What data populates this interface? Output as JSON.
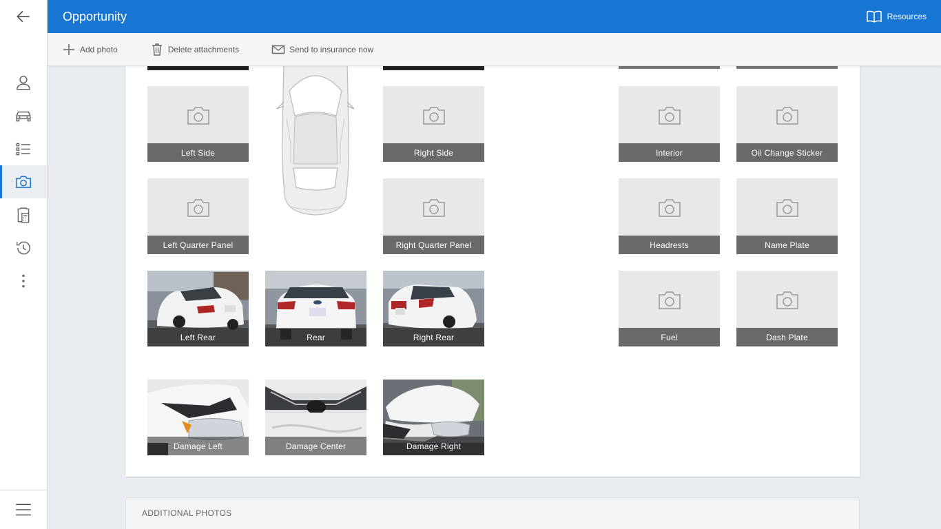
{
  "header": {
    "title": "Opportunity",
    "resources_label": "Resources"
  },
  "toolbar": {
    "add_photo": "Add photo",
    "delete_attachments": "Delete attachments",
    "send_insurance": "Send to insurance now"
  },
  "nav": {
    "items": [
      "back-arrow-icon",
      "user-icon",
      "car-icon",
      "checklist-icon",
      "camera-icon",
      "clipboard-calculator-icon",
      "history-icon",
      "more-vertical-icon"
    ],
    "active": "camera-icon",
    "bottom": "menu-icon"
  },
  "photos": {
    "left_side": "Left Side",
    "right_side": "Right Side",
    "left_quarter_panel": "Left Quarter Panel",
    "right_quarter_panel": "Right Quarter Panel",
    "left_rear": "Left Rear",
    "rear": "Rear",
    "right_rear": "Right Rear",
    "damage_left": "Damage Left",
    "damage_center": "Damage Center",
    "damage_right": "Damage Right",
    "interior": "Interior",
    "oil_change_sticker": "Oil Change Sticker",
    "headrests": "Headrests",
    "name_plate": "Name Plate",
    "fuel": "Fuel",
    "dash_plate": "Dash Plate"
  },
  "additional_photos": {
    "title": "ADDITIONAL PHOTOS"
  },
  "colors": {
    "primary": "#1976d2",
    "label_bg": "#6a6a6a",
    "placeholder_bg": "#e8e8e8"
  }
}
